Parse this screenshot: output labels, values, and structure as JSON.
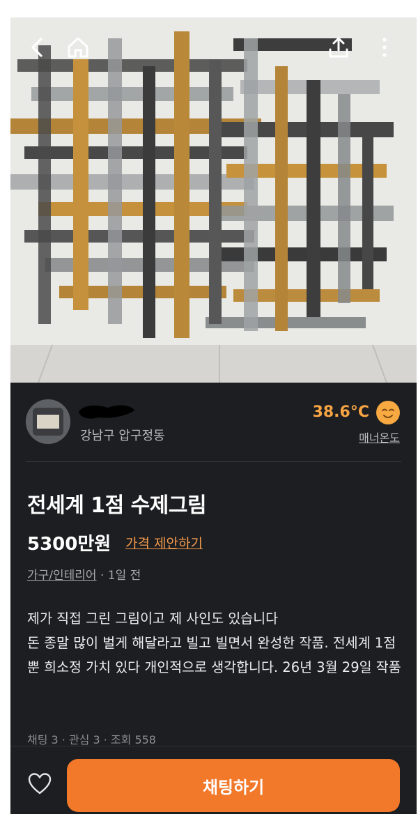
{
  "seller": {
    "location": "강남구 압구정동",
    "temperature": "38.6°C",
    "temperature_label": "매너온도"
  },
  "product": {
    "title": "전세계 1점 수제그림",
    "price": "5300만원",
    "offer_label": "가격 제안하기",
    "category": "가구/인테리어",
    "posted": " · 1일 전",
    "description": "제가 직접 그린 그림이고 제 사인도 있습니다\n돈 종말 많이 벌게 해달라고 빌고 빌면서 완성한 작품. 전세계 1점 뿐 희소정 가치 있다 개인적으로 생각합니다. 26년 3월 29일 작품",
    "stats": "채팅 3 · 관심 3 · 조회 558"
  },
  "bottom_bar": {
    "chat_button": "채팅하기"
  },
  "icons": {
    "back": "chevron-left",
    "home": "home",
    "share": "share",
    "more": "more-vertical",
    "like": "heart-outline",
    "temp_face": "smiling-face"
  },
  "colors": {
    "accent": "#f2782a",
    "temperature": "#f6a444",
    "background": "#1d1e21"
  }
}
